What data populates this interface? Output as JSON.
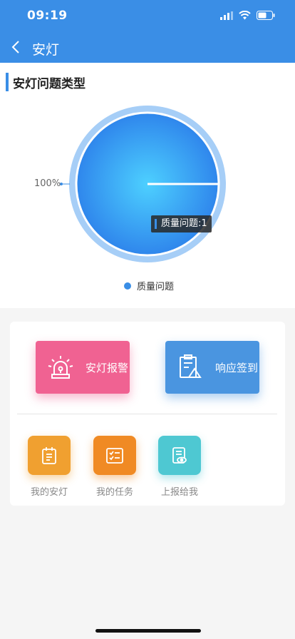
{
  "status_bar": {
    "time": "09:19"
  },
  "nav": {
    "title": "安灯"
  },
  "section": {
    "title": "安灯问题类型"
  },
  "chart_data": {
    "type": "pie",
    "categories": [
      "质量问题"
    ],
    "values": [
      1
    ],
    "percent_labels": [
      "100%"
    ],
    "tooltip": "质量问题:1",
    "legend": [
      "质量问题"
    ],
    "legend_position": "bottom",
    "colors": [
      "#3a8ee6"
    ]
  },
  "actions": {
    "alarm": {
      "label": "安灯报警",
      "color": "#f06292",
      "icon": "siren-icon"
    },
    "checkin": {
      "label": "响应签到",
      "color": "#4a95e0",
      "icon": "clipboard-icon"
    }
  },
  "shortcuts": [
    {
      "label": "我的安灯",
      "color": "#f0a030",
      "icon": "calendar-doc-icon"
    },
    {
      "label": "我的任务",
      "color": "#f08a24",
      "icon": "task-list-icon"
    },
    {
      "label": "上报给我",
      "color": "#4ec8d2",
      "icon": "report-view-icon"
    }
  ]
}
